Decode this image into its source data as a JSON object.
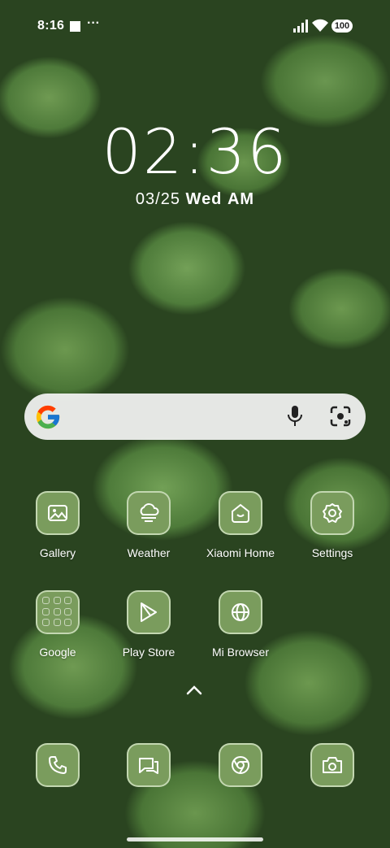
{
  "status_bar": {
    "time": "8:16",
    "overflow": "···",
    "battery": "100"
  },
  "lock_clock": {
    "time": "02:36",
    "date": "03/25",
    "weekday": "Wed",
    "period": "AM"
  },
  "search": {
    "engine": "Google",
    "icons": [
      "google-logo-icon",
      "mic-icon",
      "lens-icon"
    ]
  },
  "apps": [
    {
      "label": "Gallery",
      "icon": "gallery-icon"
    },
    {
      "label": "Weather",
      "icon": "weather-icon"
    },
    {
      "label": "Xiaomi Home",
      "icon": "xiaomi-home-icon"
    },
    {
      "label": "Settings",
      "icon": "gear-icon"
    },
    {
      "label": "Google",
      "icon": "folder-icon"
    },
    {
      "label": "Play Store",
      "icon": "play-store-icon"
    },
    {
      "label": "Mi Browser",
      "icon": "browser-icon"
    }
  ],
  "dock": [
    {
      "icon": "phone-icon"
    },
    {
      "icon": "messages-icon"
    },
    {
      "icon": "chrome-icon"
    },
    {
      "icon": "camera-icon"
    }
  ],
  "colors": {
    "icon_bg": "#7a9c5d",
    "search_bg": "#f5f5f5"
  }
}
